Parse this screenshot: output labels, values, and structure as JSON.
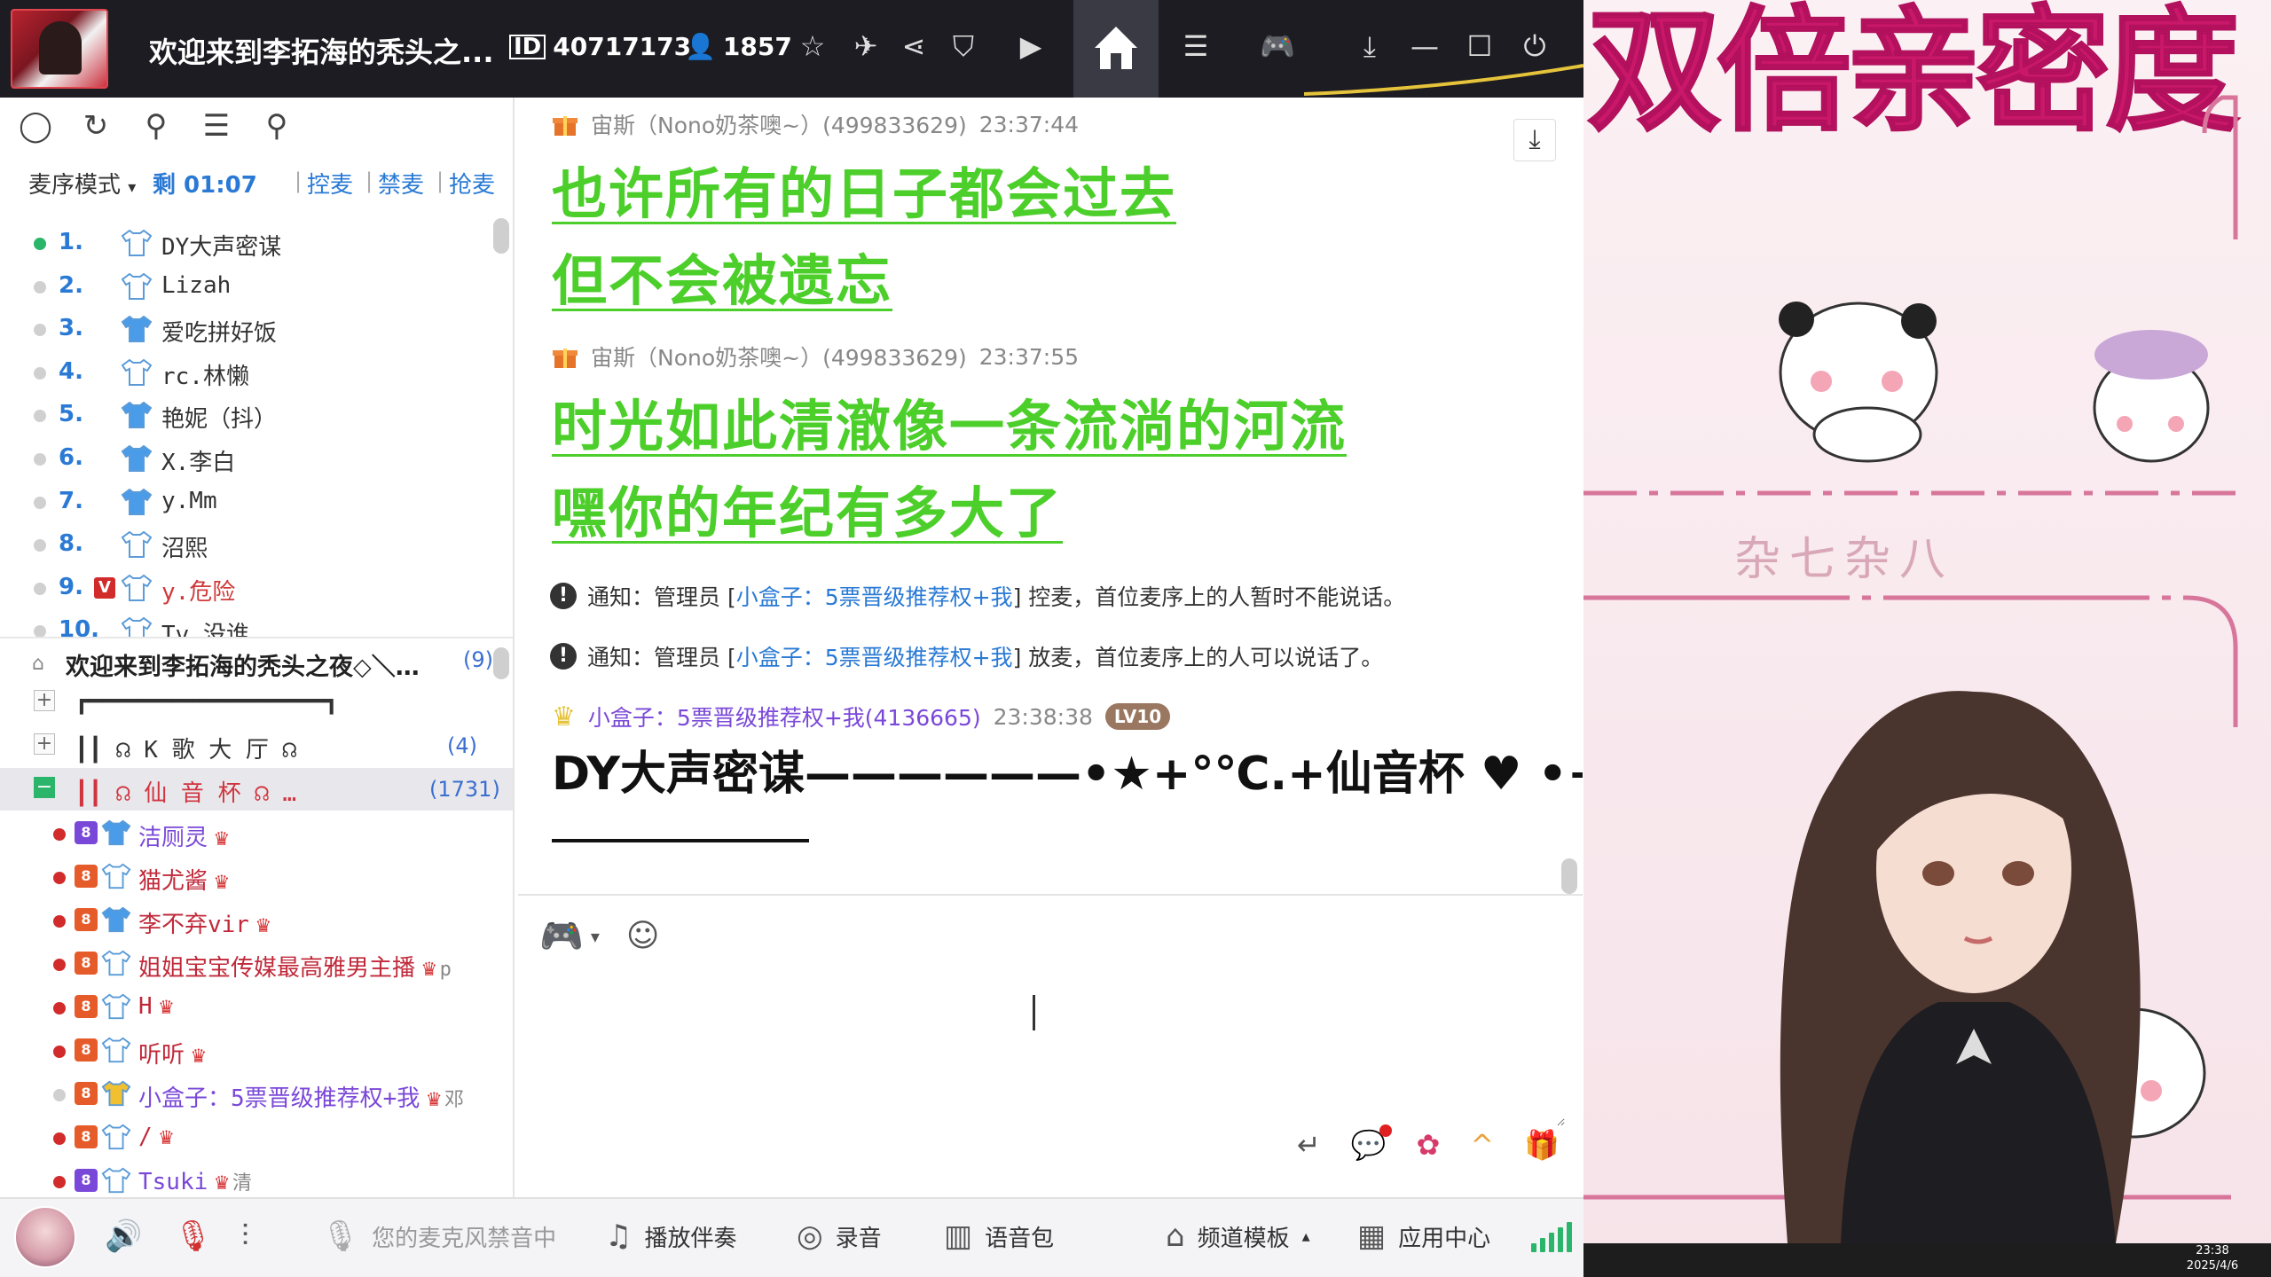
{
  "titlebar": {
    "room_title": "欢迎来到李拓海的秃头之...",
    "room_id": "40717173",
    "online_count": "1857"
  },
  "sidebar": {
    "mic_mode": "麦序模式",
    "remain": "剩 01:07",
    "actions": [
      "控麦",
      "禁麦",
      "抢麦"
    ],
    "queue": [
      {
        "num": "1.",
        "name": "DY大声密谋",
        "on": true,
        "red": false,
        "badge": ""
      },
      {
        "num": "2.",
        "name": "Lizah",
        "on": false,
        "red": false,
        "badge": ""
      },
      {
        "num": "3.",
        "name": "爱吃拼好饭",
        "on": false,
        "red": false,
        "badge": ""
      },
      {
        "num": "4.",
        "name": "rc.林懒",
        "on": false,
        "red": false,
        "badge": ""
      },
      {
        "num": "5.",
        "name": "艳妮（抖）",
        "on": false,
        "red": false,
        "badge": ""
      },
      {
        "num": "6.",
        "name": "X.李白",
        "on": false,
        "red": false,
        "badge": ""
      },
      {
        "num": "7.",
        "name": "y.Mm",
        "on": false,
        "red": false,
        "badge": ""
      },
      {
        "num": "8.",
        "name": "沼熙",
        "on": false,
        "red": false,
        "badge": ""
      },
      {
        "num": "9.",
        "name": "y.危险",
        "on": false,
        "red": true,
        "badge": "V"
      },
      {
        "num": "10.",
        "name": "Tv.没谁",
        "on": false,
        "red": false,
        "badge": ""
      }
    ],
    "channel_root": {
      "name": "欢迎来到李拓海的秃头之夜◇＼…",
      "count": "(9)"
    },
    "channels": [
      {
        "label": "┏━━━━━━━━━━━━━━━━━┓",
        "count": "",
        "toggle": "+"
      },
      {
        "label": "┃┃  ☊ K 歌 大 厅 ☊",
        "count": "(4)",
        "toggle": "+"
      },
      {
        "label": "┃┃  ☊  仙 音 杯  ☊  …",
        "count": "(1731)",
        "toggle": "−"
      }
    ],
    "users": [
      {
        "lv": "8",
        "name": "洁厕灵",
        "extra": "",
        "dot": true
      },
      {
        "lv": "8",
        "name": "猫尤酱",
        "extra": "",
        "dot": true
      },
      {
        "lv": "8",
        "name": "李不弃vir",
        "extra": "",
        "dot": true
      },
      {
        "lv": "8",
        "name": "姐姐宝宝传媒最高雅男主播",
        "extra": "p",
        "dot": true
      },
      {
        "lv": "8",
        "name": "H",
        "extra": "",
        "dot": true
      },
      {
        "lv": "8",
        "name": "听听",
        "extra": "",
        "dot": true
      },
      {
        "lv": "8",
        "name": "小盒子：5票晋级推荐权+我",
        "extra": "邓",
        "dot": false
      },
      {
        "lv": "8",
        "name": "/",
        "extra": "",
        "dot": true
      },
      {
        "lv": "8",
        "name": "Tsuki",
        "extra": "清",
        "dot": true
      }
    ]
  },
  "chat": {
    "messages": [
      {
        "sender": "宙斯（Nono奶茶噢~）(499833629)",
        "time": "23:37:44",
        "lines": [
          "也许所有的日子都会过去",
          "但不会被遗忘"
        ]
      },
      {
        "sender": "宙斯（Nono奶茶噢~）(499833629)",
        "time": "23:37:55",
        "lines": [
          "时光如此清澈像一条流淌的河流",
          "嘿你的年纪有多大了"
        ]
      }
    ],
    "notices": [
      {
        "prefix": "通知：管理员 [",
        "link": "小盒子：5票晋级推荐权+我",
        "suffix": "] 控麦，首位麦序上的人暂时不能说话。"
      },
      {
        "prefix": "通知：管理员 [",
        "link": "小盒子：5票晋级推荐权+我",
        "suffix": "] 放麦，首位麦序上的人可以说话了。"
      }
    ],
    "last_sender": "小盒子：5票晋级推荐权+我(4136665)",
    "last_time": "23:38:38",
    "last_level": "LV10",
    "last_text": "DY大声密谋——————•★+°℃.+仙音杯 ♥ •+✶"
  },
  "bottombar": {
    "mic_muted": "您的麦克风禁音中",
    "play_accompany": "播放伴奏",
    "record": "录音",
    "voice_pack": "语音包",
    "channel_template": "频道模板",
    "app_center": "应用中心"
  },
  "stream": {
    "title": "双倍亲密度",
    "subtitle": "杂七杂八",
    "clock_time": "23:38",
    "clock_date": "2025/4/6"
  },
  "colors": {
    "accent_blue": "#2a7ad5",
    "chat_green": "#4ccf2a",
    "stream_pink": "#c9176a",
    "titlebar_bg": "#1c1c22"
  }
}
